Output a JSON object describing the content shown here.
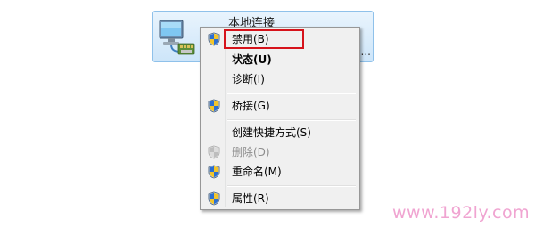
{
  "connection": {
    "title": "本地连接",
    "ellipsis": "..."
  },
  "menu": {
    "items": [
      {
        "label": "禁用(B)",
        "icon": "uac-shield-icon",
        "bold": false,
        "disabled": false
      },
      {
        "label": "状态(U)",
        "icon": "",
        "bold": true,
        "disabled": false
      },
      {
        "label": "诊断(I)",
        "icon": "",
        "bold": false,
        "disabled": false
      },
      {
        "label": "桥接(G)",
        "icon": "uac-shield-icon",
        "bold": false,
        "disabled": false
      },
      {
        "label": "创建快捷方式(S)",
        "icon": "",
        "bold": false,
        "disabled": false
      },
      {
        "label": "删除(D)",
        "icon": "uac-shield-icon",
        "bold": false,
        "disabled": true
      },
      {
        "label": "重命名(M)",
        "icon": "uac-shield-icon",
        "bold": false,
        "disabled": false
      },
      {
        "label": "属性(R)",
        "icon": "uac-shield-icon",
        "bold": false,
        "disabled": false
      }
    ]
  },
  "highlight_color": "#d6131b",
  "watermark": "www.192ly.com"
}
